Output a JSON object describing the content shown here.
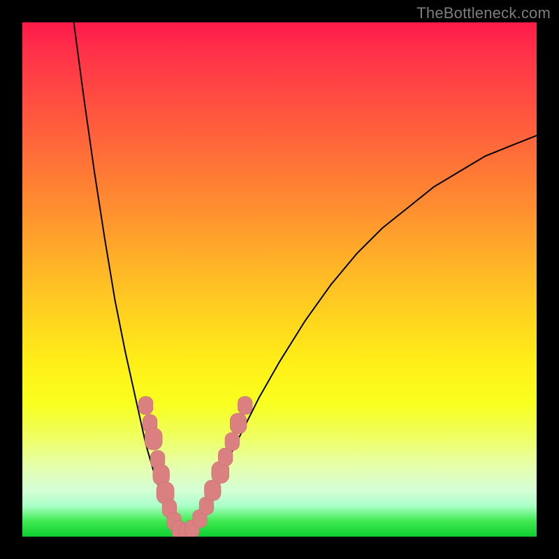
{
  "watermark": "TheBottleneck.com",
  "colors": {
    "background": "#000000",
    "curve": "#000000",
    "marker_fill": "#db8080",
    "marker_stroke": "#c67272"
  },
  "chart_data": {
    "type": "line",
    "title": "",
    "xlabel": "",
    "ylabel": "",
    "xlim": [
      0,
      100
    ],
    "ylim": [
      0,
      100
    ],
    "vertex_x": 31,
    "series": [
      {
        "name": "bottleneck-curve-left",
        "x": [
          10,
          12,
          14,
          16,
          18,
          20,
          22,
          24,
          26,
          28,
          30,
          31
        ],
        "y": [
          100,
          85,
          71,
          58,
          46,
          36,
          27,
          18,
          11,
          6,
          2,
          0
        ]
      },
      {
        "name": "bottleneck-curve-right",
        "x": [
          31,
          34,
          38,
          42,
          46,
          50,
          55,
          60,
          65,
          70,
          75,
          80,
          85,
          90,
          95,
          100
        ],
        "y": [
          0,
          4,
          11,
          19,
          27,
          34,
          42,
          49,
          55,
          60,
          64,
          68,
          71,
          74,
          76,
          78
        ]
      }
    ],
    "markers": [
      {
        "x": 24.0,
        "y": 25.5,
        "r": 1.4
      },
      {
        "x": 24.8,
        "y": 22.0,
        "r": 1.4
      },
      {
        "x": 25.5,
        "y": 19.0,
        "r": 1.7
      },
      {
        "x": 26.3,
        "y": 15.0,
        "r": 1.4
      },
      {
        "x": 27.0,
        "y": 12.0,
        "r": 1.6
      },
      {
        "x": 27.8,
        "y": 8.5,
        "r": 1.7
      },
      {
        "x": 28.6,
        "y": 5.5,
        "r": 1.4
      },
      {
        "x": 29.5,
        "y": 3.0,
        "r": 1.4
      },
      {
        "x": 30.5,
        "y": 1.3,
        "r": 1.4
      },
      {
        "x": 31.8,
        "y": 0.7,
        "r": 1.4
      },
      {
        "x": 33.0,
        "y": 1.5,
        "r": 1.4
      },
      {
        "x": 34.5,
        "y": 3.5,
        "r": 1.4
      },
      {
        "x": 35.8,
        "y": 6.0,
        "r": 1.4
      },
      {
        "x": 37.0,
        "y": 9.0,
        "r": 1.6
      },
      {
        "x": 38.5,
        "y": 12.5,
        "r": 1.7
      },
      {
        "x": 39.5,
        "y": 15.5,
        "r": 1.4
      },
      {
        "x": 40.8,
        "y": 18.5,
        "r": 1.4
      },
      {
        "x": 42.0,
        "y": 22.0,
        "r": 1.6
      },
      {
        "x": 43.3,
        "y": 25.5,
        "r": 1.4
      }
    ]
  }
}
